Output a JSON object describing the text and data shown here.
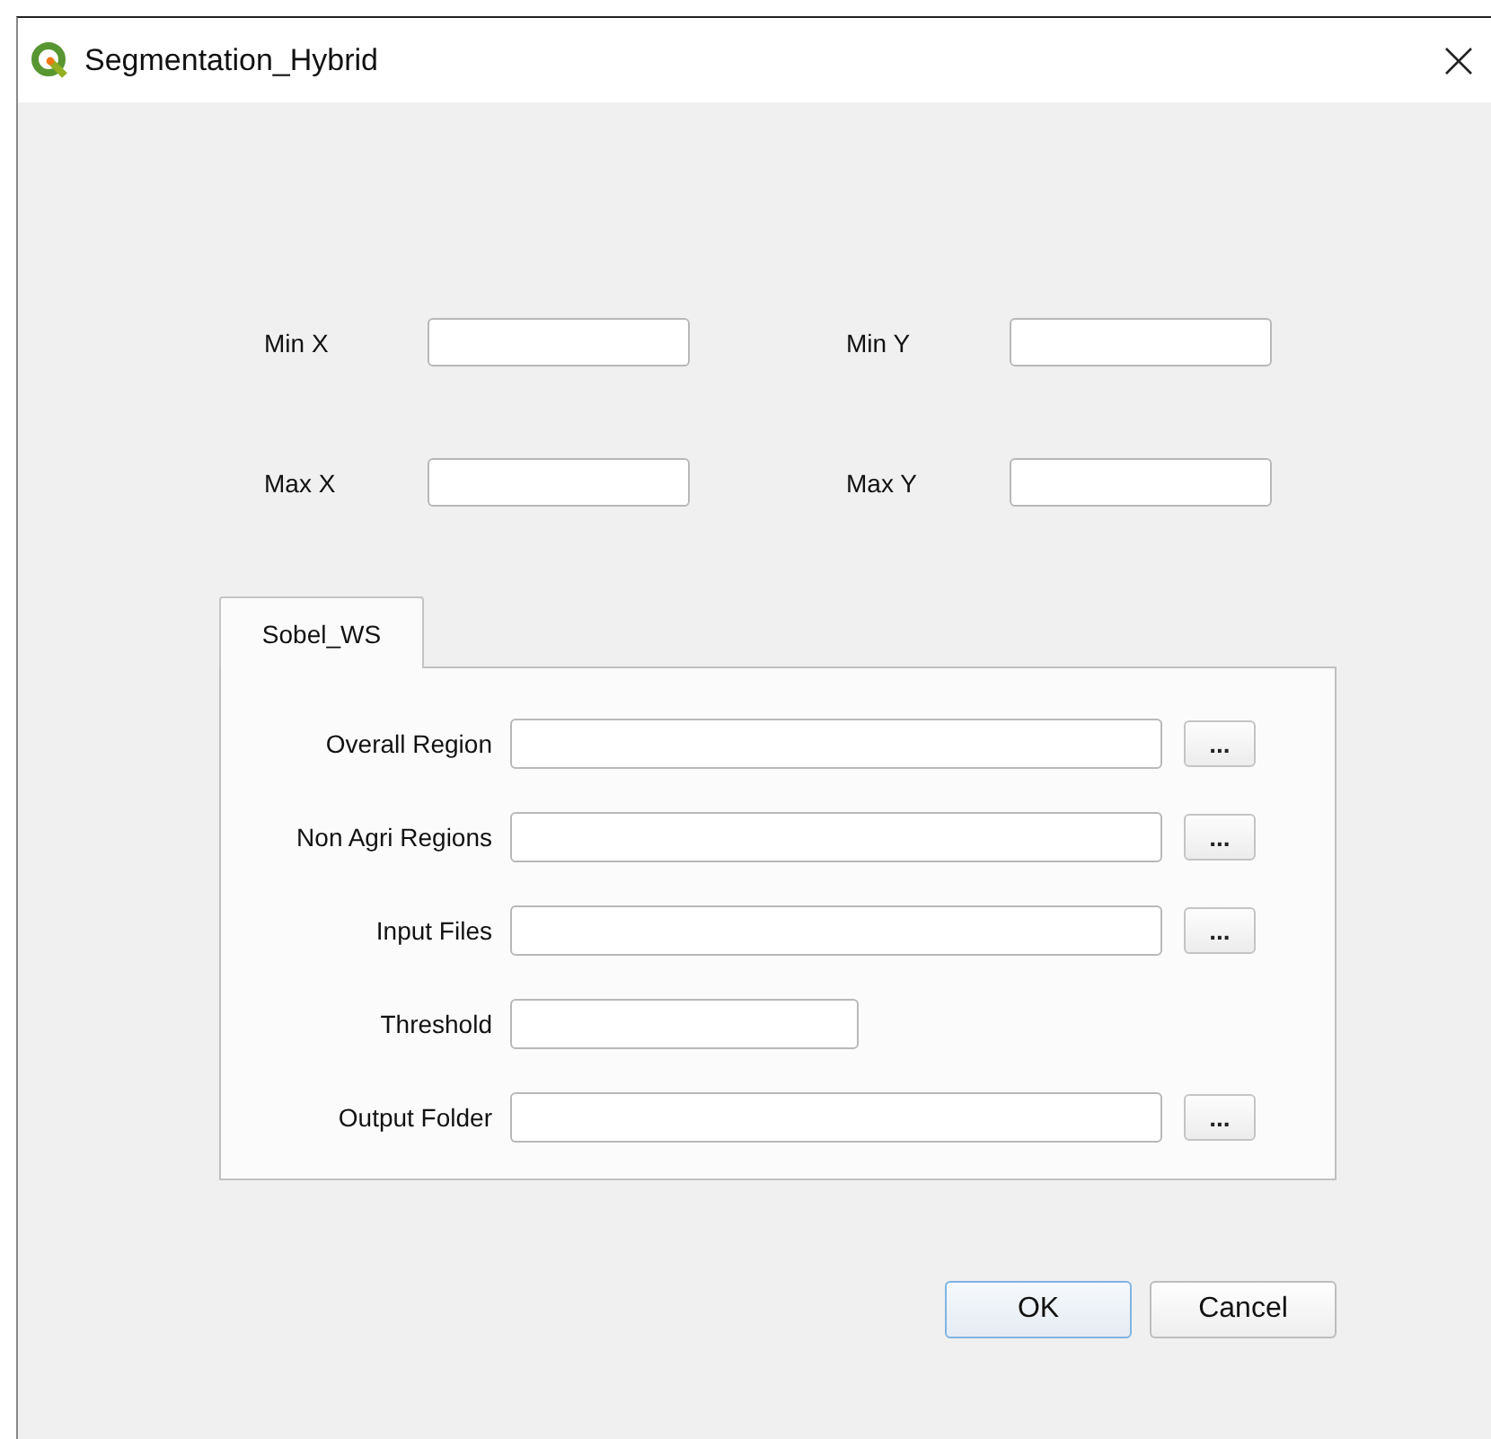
{
  "window": {
    "title": "Segmentation_Hybrid"
  },
  "extent_fields": [
    {
      "label": "Min X"
    },
    {
      "label": "Min Y"
    },
    {
      "label": "Max X"
    },
    {
      "label": "Max Y"
    }
  ],
  "tabs": [
    {
      "label": "Sobel_WS",
      "selected": true
    }
  ],
  "form_rows": [
    {
      "label": "Overall Region",
      "kind": "file",
      "browse": "..."
    },
    {
      "label": "Non Agri Regions",
      "kind": "file",
      "browse": "..."
    },
    {
      "label": "Input Files",
      "kind": "file",
      "browse": "..."
    },
    {
      "label": "Threshold",
      "kind": "number"
    },
    {
      "label": "Output Folder",
      "kind": "file",
      "browse": "..."
    }
  ],
  "buttons": [
    {
      "label": "OK",
      "default": true
    },
    {
      "label": "Cancel",
      "default": false
    }
  ]
}
